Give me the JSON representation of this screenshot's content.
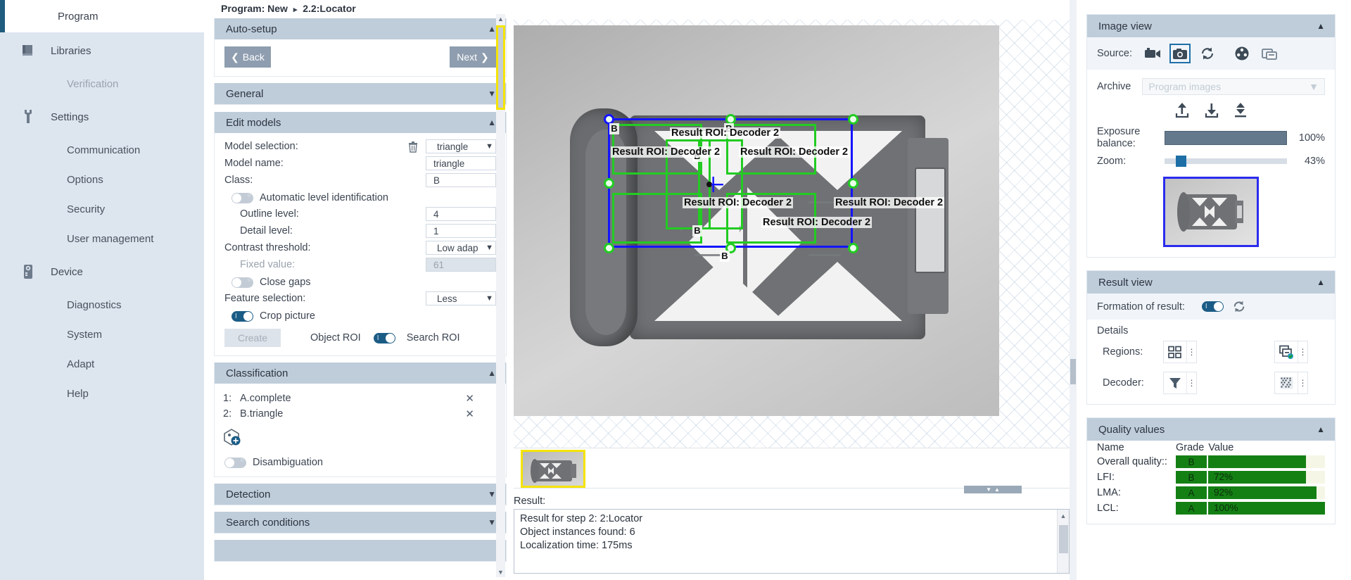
{
  "sidebar": {
    "program_label": "Program",
    "groups": [
      {
        "icon": "book-icon",
        "label": "Libraries",
        "items": [
          {
            "label": "Verification",
            "dim": true
          }
        ]
      },
      {
        "icon": "wrench-icon",
        "label": "Settings",
        "items": [
          {
            "label": "Communication"
          },
          {
            "label": "Options"
          },
          {
            "label": "Security"
          },
          {
            "label": "User management"
          }
        ]
      },
      {
        "icon": "device-icon",
        "label": "Device",
        "items": [
          {
            "label": "Diagnostics"
          },
          {
            "label": "System"
          },
          {
            "label": "Adapt"
          },
          {
            "label": "Help"
          }
        ]
      }
    ]
  },
  "breadcrumb": {
    "prefix": "Program: New",
    "separator": "▸",
    "current": "2.2:Locator"
  },
  "panels": {
    "autosetup": {
      "title": "Auto-setup",
      "back": "Back",
      "next": "Next"
    },
    "general": {
      "title": "General"
    },
    "edit_models": {
      "title": "Edit models",
      "model_selection_label": "Model selection:",
      "model_selection_value": "triangle",
      "model_name_label": "Model name:",
      "model_name_value": "triangle",
      "class_label": "Class:",
      "class_value": "B",
      "auto_level_label": "Automatic level identification",
      "auto_level_state": "off",
      "outline_level_label": "Outline level:",
      "outline_level_value": "4",
      "detail_level_label": "Detail level:",
      "detail_level_value": "1",
      "contrast_threshold_label": "Contrast threshold:",
      "contrast_threshold_value": "Low adapt",
      "fixed_value_label": "Fixed value:",
      "fixed_value_value": "61",
      "close_gaps_label": "Close gaps",
      "close_gaps_state": "off",
      "feature_selection_label": "Feature selection:",
      "feature_selection_value": "Less",
      "crop_picture_label": "Crop picture",
      "crop_picture_state": "on",
      "create_label": "Create",
      "object_roi_label": "Object ROI",
      "roi_toggle_state": "on",
      "search_roi_label": "Search ROI"
    },
    "classification": {
      "title": "Classification",
      "entries": [
        {
          "index": "1:",
          "name": "A.complete"
        },
        {
          "index": "2:",
          "name": "B.triangle"
        }
      ],
      "disambiguation_label": "Disambiguation",
      "disambiguation_state": "off"
    },
    "detection": {
      "title": "Detection"
    },
    "search_conditions": {
      "title": "Search conditions"
    }
  },
  "image_area": {
    "roi_labels": [
      "Result ROI:  Decoder 2",
      "Result ROI:  Decoder 2",
      "Result ROI:  Decoder 2",
      "Result ROI:  Decoder 2",
      "Result ROI:  Decoder 2",
      "Result ROI:  Decoder 2"
    ],
    "class_flags": [
      "B",
      "B",
      "B",
      "B",
      "B"
    ],
    "result_label": "Result:",
    "result_lines": [
      "Result for step 2: 2:Locator",
      "Object instances found: 6",
      "Localization time: 175ms"
    ]
  },
  "image_view": {
    "title": "Image view",
    "source_label": "Source:",
    "source_icons": [
      "video-camera-icon",
      "photo-camera-icon",
      "refresh-icon",
      "film-reel-icon",
      "copy-image-icon"
    ],
    "selected_source": "photo-camera-icon",
    "archive_label": "Archive",
    "archive_value": "Program images",
    "action_icons": [
      "upload-icon",
      "download-icon",
      "transfer-icon"
    ],
    "exposure_label": "Exposure balance:",
    "exposure_value": "100%",
    "zoom_label": "Zoom:",
    "zoom_value": "43%"
  },
  "result_view": {
    "title": "Result view",
    "formation_label": "Formation of result:",
    "formation_state": "on",
    "refresh_icon": "refresh-icon",
    "details_label": "Details",
    "regions_label": "Regions:",
    "regions_icons": [
      "regions-layout-icon",
      "regions-overlap-check-icon"
    ],
    "decoder_label": "Decoder:",
    "decoder_icons": [
      "filter-funnel-icon",
      "datamatrix-icon"
    ]
  },
  "quality_values": {
    "title": "Quality values",
    "columns": [
      "Name",
      "Grade",
      "Value"
    ],
    "rows": [
      {
        "name": "Overall quality::",
        "grade": "B",
        "value": "",
        "pct": 84
      },
      {
        "name": "LFI:",
        "grade": "B",
        "value": "72%",
        "pct": 84
      },
      {
        "name": "LMA:",
        "grade": "A",
        "value": "92%",
        "pct": 93
      },
      {
        "name": "LCL:",
        "grade": "A",
        "value": "100%",
        "pct": 100
      }
    ]
  },
  "colors": {
    "accent": "#1b5c86",
    "panel_header": "#bfcdda",
    "sidebar_bg": "#dde5ef",
    "roi_green": "#22cc22",
    "roi_blue": "#1414ff",
    "quality_green": "#148014",
    "thumb_highlight": "#f5e400"
  }
}
